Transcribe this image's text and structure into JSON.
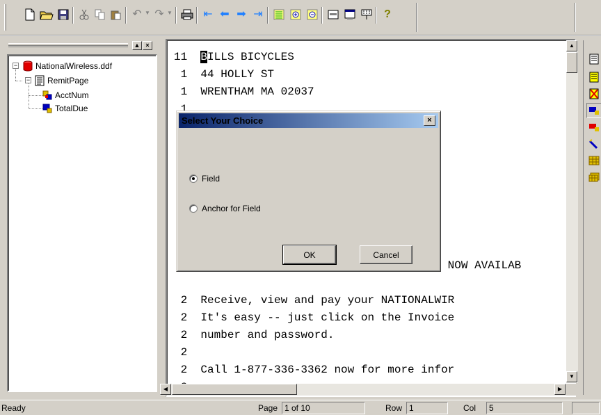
{
  "toolbar": {
    "icons": [
      "new-file",
      "open-folder",
      "save",
      "cut",
      "copy",
      "paste",
      "undo",
      "redo",
      "print",
      "first-page",
      "previous-page",
      "next-page",
      "last-page",
      "list-view",
      "zoom-in",
      "zoom-out",
      "field-view",
      "window-view",
      "tools",
      "help"
    ]
  },
  "tree": {
    "items": [
      {
        "label": "NationalWireless.ddf"
      },
      {
        "label": "RemitPage"
      },
      {
        "label": "AcctNum"
      },
      {
        "label": "TotalDue"
      }
    ]
  },
  "document": {
    "lines": [
      {
        "num": "11",
        "cursor": "B",
        "text": "ILLS BICYCLES"
      },
      {
        "num": " 1",
        "cursor": "",
        "text": "44 HOLLY ST"
      },
      {
        "num": " 1",
        "cursor": "",
        "text": "WRENTHAM MA 02037"
      },
      {
        "num": " 1",
        "cursor": "",
        "text": ""
      },
      {
        "num": "",
        "cursor": "",
        "text": ""
      },
      {
        "num": "",
        "cursor": "",
        "text": ""
      },
      {
        "num": "",
        "cursor": "",
        "text": ""
      },
      {
        "num": "",
        "cursor": "",
        "text": ""
      },
      {
        "num": "",
        "cursor": "",
        "text": ""
      },
      {
        "num": "",
        "cursor": "",
        "text": ""
      },
      {
        "num": "",
        "cursor": "",
        "text": ""
      },
      {
        "num": "",
        "cursor": "",
        "text": ""
      },
      {
        "num": "",
        "cursor": "",
        "text": "                                   G NOW AVAILAB"
      },
      {
        "num": "",
        "cursor": "",
        "text": ""
      },
      {
        "num": " 2",
        "cursor": "",
        "text": "Receive, view and pay your NATIONALWIR"
      },
      {
        "num": " 2",
        "cursor": "",
        "text": "It's easy -- just click on the Invoice"
      },
      {
        "num": " 2",
        "cursor": "",
        "text": "number and password."
      },
      {
        "num": " 2",
        "cursor": "",
        "text": ""
      },
      {
        "num": " 2",
        "cursor": "",
        "text": "Call 1-877-336-3362 now for more infor"
      },
      {
        "num": " 2",
        "cursor": "",
        "text": ""
      }
    ]
  },
  "dialog": {
    "title": "Select Your Choice",
    "close": "×",
    "options": [
      {
        "label": "Field",
        "selected": true
      },
      {
        "label": "Anchor for Field",
        "selected": false
      }
    ],
    "ok": "OK",
    "cancel": "Cancel"
  },
  "status": {
    "ready": "Ready",
    "page_label": "Page",
    "page_value": "1 of 10",
    "row_label": "Row",
    "row_value": "1",
    "col_label": "Col",
    "col_value": "5"
  }
}
